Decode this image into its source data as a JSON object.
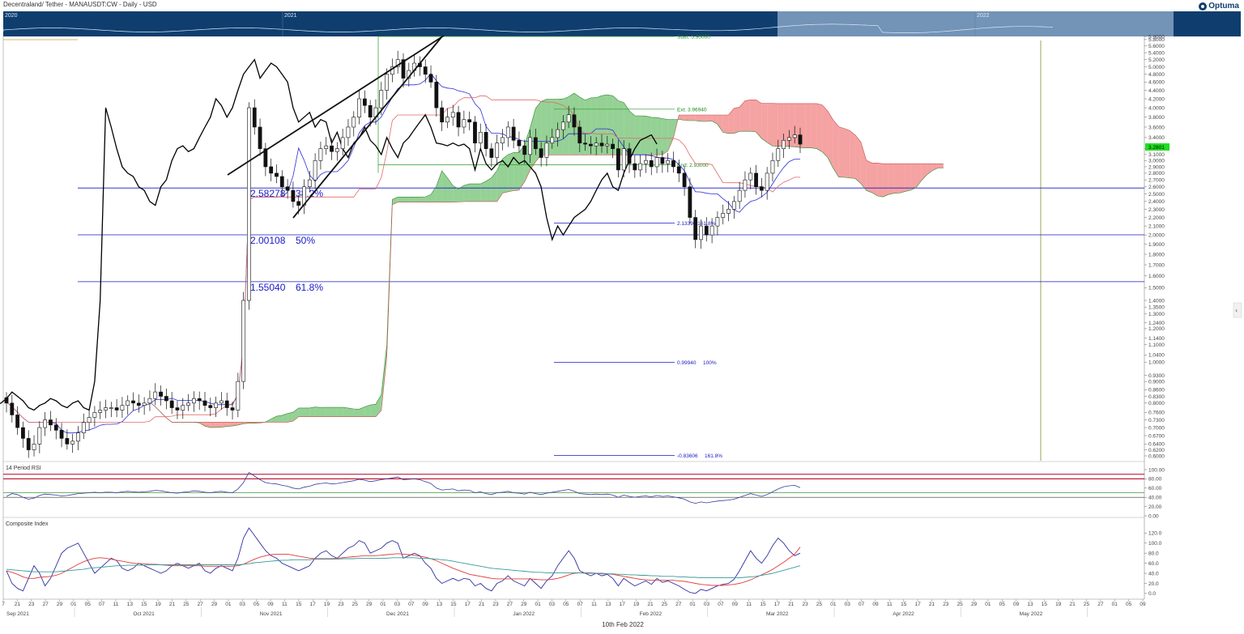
{
  "header": {
    "title": "Decentraland/ Tether - MANAUSDT:CW - Daily - USD",
    "logo": "Optuma",
    "nav_years": [
      "2020",
      "2021",
      "2022"
    ]
  },
  "footer": {
    "date_label": "10th Feb 2022"
  },
  "colors": {
    "accent": "#0f3e6e",
    "bull_cloud": "#5cb85c",
    "bear_cloud": "#f07070",
    "fib": "#1818c8",
    "price_tag": "#22dd22"
  },
  "panels": {
    "rsi_label": "14 Period RSI",
    "ci_label": "Composite Index"
  },
  "chart_data": [
    {
      "type": "candlestick",
      "title": "Decentraland/ Tether - MANAUSDT:CW - Daily - USD",
      "scale": "log",
      "ylim": [
        0.59,
        5.95
      ],
      "y_ticks": [
        "5.9000",
        "5.8000",
        "5.6000",
        "5.4000",
        "5.2000",
        "5.0000",
        "4.8000",
        "4.6000",
        "4.4000",
        "4.2000",
        "4.0000",
        "3.8000",
        "3.6000",
        "3.4000",
        "3.2000",
        "3.1000",
        "3.0000",
        "2.9000",
        "2.8000",
        "2.7000",
        "2.6000",
        "2.5000",
        "2.4000",
        "2.3000",
        "2.2000",
        "2.1000",
        "2.0000",
        "1.9000",
        "1.8000",
        "1.7000",
        "1.6000",
        "1.5000",
        "1.4000",
        "1.3500",
        "1.3000",
        "1.2400",
        "1.2000",
        "1.1400",
        "1.1000",
        "1.0400",
        "1.0000",
        "0.9300",
        "0.9000",
        "0.8600",
        "0.8300",
        "0.8000",
        "0.7600",
        "0.7300",
        "0.7000",
        "0.6700",
        "0.6400",
        "0.6200",
        "0.6000"
      ],
      "current_price": "3.2801",
      "x_tick_labels": [
        "7",
        "21",
        "23",
        "27",
        "29",
        "01",
        "05",
        "07",
        "11",
        "13",
        "15",
        "19",
        "21",
        "25",
        "27",
        "29",
        "01",
        "03",
        "05",
        "09",
        "11",
        "15",
        "17",
        "19",
        "23",
        "25",
        "29",
        "01",
        "03",
        "07",
        "09",
        "13",
        "15",
        "17",
        "21",
        "23",
        "27",
        "29",
        "01",
        "03",
        "05",
        "07",
        "11",
        "13",
        "17",
        "19",
        "21",
        "25",
        "27",
        "01",
        "03",
        "07",
        "09",
        "11",
        "15",
        "17",
        "21",
        "23",
        "25",
        "01",
        "03",
        "07",
        "09",
        "11",
        "15",
        "17",
        "21",
        "23",
        "25",
        "29",
        "01",
        "05",
        "09",
        "13",
        "15",
        "19",
        "21",
        "25",
        "27",
        "01",
        "05",
        "09"
      ],
      "month_labels": [
        "Sep 2021",
        "Oct 2021",
        "Nov 2021",
        "Dec 2021",
        "Jan 2022",
        "Feb 2022",
        "Mar 2022",
        "Apr 2022",
        "May 2022"
      ],
      "close": [
        0.8,
        0.75,
        0.7,
        0.66,
        0.62,
        0.64,
        0.7,
        0.73,
        0.71,
        0.69,
        0.66,
        0.64,
        0.65,
        0.68,
        0.72,
        0.74,
        0.76,
        0.77,
        0.78,
        0.78,
        0.77,
        0.79,
        0.81,
        0.8,
        0.79,
        0.8,
        0.82,
        0.85,
        0.83,
        0.81,
        0.78,
        0.77,
        0.79,
        0.8,
        0.82,
        0.81,
        0.79,
        0.78,
        0.8,
        0.81,
        0.78,
        0.77,
        0.9,
        1.4,
        4.0,
        3.6,
        3.2,
        2.9,
        2.8,
        2.75,
        2.6,
        2.55,
        2.4,
        2.35,
        2.6,
        2.7,
        3.0,
        3.2,
        3.25,
        3.15,
        3.2,
        3.4,
        3.6,
        3.8,
        4.2,
        4.05,
        3.8,
        4.0,
        4.4,
        4.8,
        5.0,
        5.2,
        4.7,
        4.9,
        5.1,
        5.0,
        4.8,
        4.6,
        4.0,
        3.7,
        3.8,
        3.9,
        3.6,
        3.75,
        3.7,
        3.3,
        3.5,
        3.2,
        3.05,
        3.3,
        3.4,
        3.6,
        3.35,
        3.25,
        3.1,
        3.4,
        3.2,
        3.05,
        3.3,
        3.4,
        3.55,
        3.7,
        3.85,
        3.6,
        3.3,
        3.28,
        3.25,
        3.3,
        3.25,
        3.28,
        3.2,
        2.85,
        3.2,
        2.95,
        2.85,
        2.95,
        3.0,
        2.9,
        3.05,
        2.95,
        3.0,
        2.9,
        2.8,
        2.6,
        2.2,
        1.95,
        2.1,
        2.0,
        2.1,
        2.2,
        2.25,
        2.3,
        2.4,
        2.55,
        2.7,
        2.8,
        2.6,
        2.55,
        2.8,
        3.0,
        3.2,
        3.35,
        3.4,
        3.45,
        3.28
      ],
      "fib_levels": [
        {
          "price": "2.58278",
          "pct": "38.2%"
        },
        {
          "price": "2.00108",
          "pct": "50%"
        },
        {
          "price": "1.55040",
          "pct": "61.8%"
        }
      ],
      "projection": [
        {
          "label": "Start: 5.90000"
        },
        {
          "label": "Ext: 3.96940"
        },
        {
          "label": "End: 2.93000"
        },
        {
          "label": "2.13396  161.8%"
        },
        {
          "label": "0.99940",
          "pct": "100%"
        },
        {
          "label": "-0.83606",
          "pct": "161.8%"
        }
      ]
    },
    {
      "type": "line",
      "title": "14 Period RSI",
      "ylim": [
        0,
        100
      ],
      "y_ticks": [
        "100.00",
        "80.00",
        "60.00",
        "40.00",
        "20.00",
        "0.00"
      ],
      "levels": [
        90,
        80,
        50,
        40
      ],
      "values": [
        42,
        48,
        46,
        40,
        36,
        38,
        44,
        47,
        46,
        45,
        43,
        44,
        46,
        48,
        49,
        50,
        51,
        50,
        51,
        51,
        50,
        52,
        53,
        52,
        51,
        52,
        53,
        55,
        54,
        52,
        50,
        49,
        51,
        52,
        54,
        53,
        51,
        50,
        52,
        53,
        51,
        50,
        58,
        72,
        94,
        86,
        78,
        72,
        70,
        69,
        66,
        64,
        60,
        58,
        62,
        64,
        68,
        70,
        71,
        69,
        70,
        72,
        74,
        76,
        79,
        77,
        74,
        76,
        78,
        80,
        82,
        84,
        78,
        79,
        80,
        78,
        74,
        70,
        60,
        56,
        57,
        58,
        54,
        56,
        55,
        50,
        52,
        48,
        46,
        50,
        51,
        53,
        50,
        49,
        47,
        51,
        48,
        46,
        49,
        51,
        53,
        55,
        57,
        53,
        48,
        47,
        46,
        47,
        46,
        47,
        45,
        40,
        45,
        42,
        40,
        42,
        43,
        41,
        44,
        42,
        43,
        41,
        39,
        36,
        30,
        27,
        30,
        28,
        30,
        32,
        33,
        34,
        36,
        40,
        44,
        48,
        45,
        42,
        46,
        52,
        58,
        63,
        65,
        66,
        61
      ]
    },
    {
      "type": "line",
      "title": "Composite Index",
      "ylim": [
        -5,
        135
      ],
      "y_ticks": [
        "120.0",
        "100.0",
        "80.0",
        "60.0",
        "40.0",
        "20.0",
        "0.0"
      ],
      "series": [
        {
          "color": "#3030a0",
          "values": [
            45,
            20,
            10,
            5,
            30,
            55,
            40,
            15,
            30,
            55,
            80,
            90,
            95,
            100,
            80,
            60,
            40,
            50,
            60,
            70,
            65,
            50,
            45,
            50,
            60,
            55,
            50,
            45,
            40,
            45,
            55,
            60,
            55,
            50,
            55,
            60,
            45,
            40,
            50,
            55,
            50,
            45,
            70,
            110,
            130,
            115,
            100,
            85,
            75,
            70,
            60,
            55,
            50,
            45,
            50,
            55,
            70,
            80,
            85,
            75,
            70,
            80,
            90,
            95,
            105,
            100,
            80,
            85,
            90,
            100,
            105,
            100,
            70,
            75,
            80,
            75,
            60,
            50,
            30,
            20,
            25,
            30,
            25,
            30,
            28,
            15,
            20,
            10,
            5,
            20,
            25,
            35,
            25,
            20,
            15,
            30,
            20,
            10,
            25,
            35,
            55,
            70,
            85,
            70,
            45,
            40,
            35,
            40,
            35,
            38,
            30,
            15,
            30,
            22,
            15,
            20,
            25,
            18,
            30,
            22,
            25,
            20,
            15,
            8,
            2,
            0,
            8,
            5,
            10,
            15,
            18,
            20,
            28,
            45,
            65,
            85,
            70,
            60,
            75,
            95,
            110,
            100,
            85,
            75,
            80
          ]
        },
        {
          "color": "#e23c3c",
          "values": [
            45,
            42,
            38,
            33,
            30,
            30,
            32,
            33,
            34,
            36,
            40,
            46,
            52,
            58,
            63,
            67,
            70,
            71,
            70,
            68,
            66,
            64,
            62,
            60,
            59,
            59,
            58,
            58,
            57,
            56,
            55,
            55,
            55,
            55,
            55,
            55,
            54,
            54,
            54,
            54,
            54,
            54,
            55,
            58,
            63,
            68,
            72,
            75,
            77,
            78,
            78,
            78,
            76,
            74,
            72,
            70,
            69,
            69,
            69,
            69,
            70,
            71,
            72,
            73,
            74,
            75,
            75,
            75,
            76,
            77,
            78,
            79,
            78,
            77,
            76,
            74,
            72,
            69,
            65,
            60,
            55,
            50,
            46,
            42,
            38,
            36,
            34,
            32,
            30,
            29,
            29,
            29,
            29,
            29,
            29,
            29,
            28,
            27,
            27,
            28,
            30,
            33,
            37,
            40,
            41,
            41,
            41,
            40,
            40,
            39,
            38,
            36,
            34,
            32,
            30,
            28,
            27,
            26,
            26,
            26,
            26,
            26,
            25,
            24,
            22,
            20,
            18,
            17,
            16,
            16,
            16,
            17,
            18,
            20,
            23,
            27,
            32,
            37,
            42,
            48,
            55,
            62,
            70,
            78,
            92
          ]
        },
        {
          "color": "#3a9a9a",
          "values": [
            48,
            47,
            46,
            45,
            44,
            43,
            43,
            43,
            43,
            43,
            44,
            45,
            46,
            47,
            48,
            50,
            51,
            52,
            53,
            54,
            55,
            55,
            56,
            56,
            56,
            56,
            57,
            57,
            57,
            57,
            57,
            57,
            57,
            57,
            57,
            57,
            57,
            57,
            57,
            57,
            57,
            57,
            57,
            58,
            59,
            61,
            62,
            63,
            64,
            65,
            66,
            66,
            67,
            67,
            67,
            67,
            68,
            68,
            68,
            68,
            68,
            69,
            69,
            69,
            70,
            70,
            70,
            70,
            70,
            70,
            71,
            71,
            71,
            71,
            71,
            70,
            70,
            69,
            68,
            67,
            66,
            64,
            62,
            60,
            58,
            56,
            54,
            52,
            50,
            49,
            48,
            47,
            46,
            45,
            44,
            43,
            42,
            42,
            41,
            41,
            41,
            41,
            41,
            41,
            41,
            40,
            40,
            40,
            39,
            39,
            39,
            38,
            38,
            37,
            37,
            36,
            36,
            35,
            35,
            34,
            34,
            34,
            33,
            33,
            32,
            32,
            31,
            31,
            31,
            31,
            31,
            31,
            31,
            31,
            32,
            33,
            34,
            36,
            38,
            40,
            43,
            46,
            49,
            52,
            55
          ]
        }
      ]
    }
  ]
}
